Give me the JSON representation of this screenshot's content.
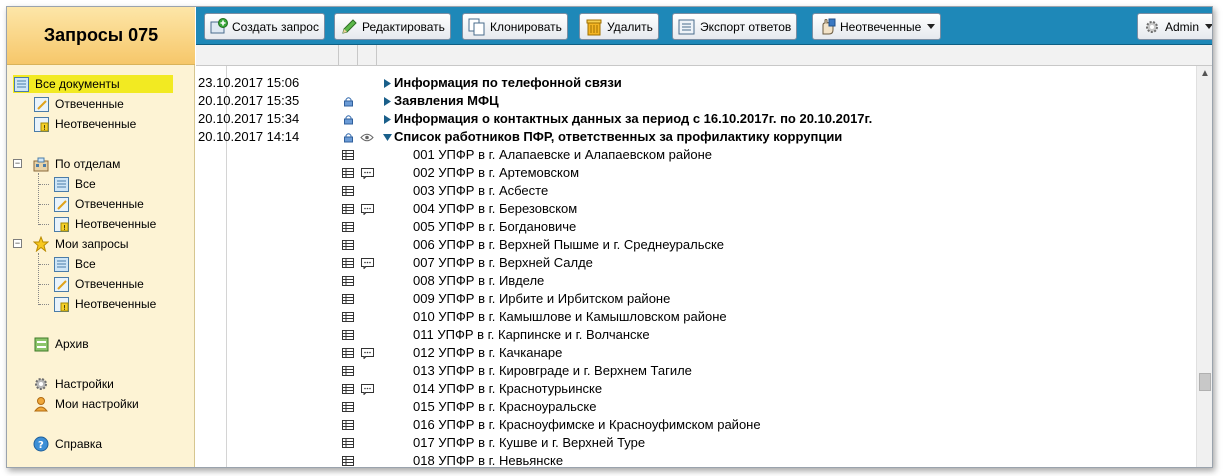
{
  "app": {
    "title": "Запросы 075"
  },
  "sidebar": {
    "all_docs": "Все документы",
    "answered": "Отвеченные",
    "unanswered": "Неотвеченные",
    "by_departments": "По отделам",
    "dept_all": "Все",
    "dept_answered": "Отвеченные",
    "dept_unanswered": "Неотвеченные",
    "my_requests": "Мои запросы",
    "my_all": "Все",
    "my_answered": "Отвеченные",
    "my_unanswered": "Неотвеченные",
    "archive": "Архив",
    "settings": "Настройки",
    "my_settings": "Мои настройки",
    "help": "Справка"
  },
  "toolbar": {
    "create": "Создать запрос",
    "edit": "Редактировать",
    "clone": "Клонировать",
    "delete": "Удалить",
    "export": "Экспорт ответов",
    "filter": "Неотвеченные",
    "user": "Admin"
  },
  "grid": {
    "requests": [
      {
        "date": "23.10.2017 15:06",
        "title": "Информация по телефонной связи"
      },
      {
        "date": "20.10.2017 15:35",
        "title": "Заявления МФЦ"
      },
      {
        "date": "20.10.2017 15:34",
        "title": "Информация о контактных данных за период с 16.10.2017г. по 20.10.2017г."
      },
      {
        "date": "20.10.2017 14:14",
        "title": "Список работников ПФР, ответственных за профилактику коррупции"
      }
    ],
    "departments": [
      "001 УПФР в г. Алапаевске и Алапаевском районе",
      "002 УПФР в г. Артемовском",
      "003 УПФР в г. Асбесте",
      "004 УПФР в г. Березовском",
      "005 УПФР в г. Богдановиче",
      "006 УПФР в г. Верхней Пышме и г. Среднеуральске",
      "007 УПФР в г. Верхней Салде",
      "008 УПФР в г. Ивделе",
      "009 УПФР в г. Ирбите и Ирбитском районе",
      "010 УПФР в г. Камышлове и Камышловском районе",
      "011 УПФР в г. Карпинске и г. Волчанске",
      "012 УПФР в г. Качканаре",
      "013 УПФР в г. Кировграде и г. Верхнем Тагиле",
      "014 УПФР в г. Краснотурьинске",
      "015 УПФР в г. Красноуральске",
      "016 УПФР в г. Красноуфимске и Красноуфимском районе",
      "017 УПФР в г. Кушве и г. Верхней Туре",
      "018 УПФР в г. Невьянске"
    ]
  },
  "colors": {
    "toolbar": "#1e88b8",
    "sidebar": "#fdf3d4",
    "active": "#f2ea22"
  }
}
